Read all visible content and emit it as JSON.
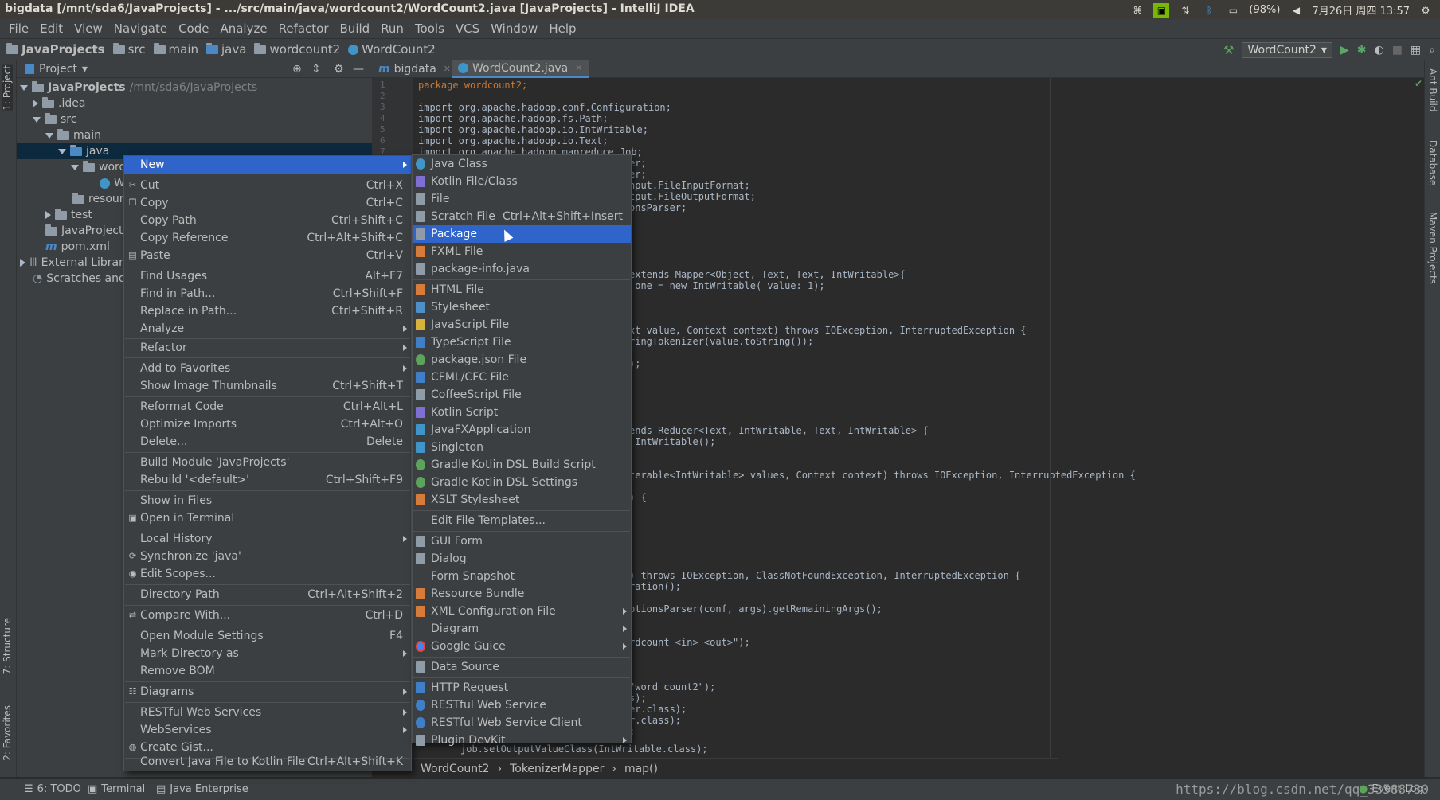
{
  "window": {
    "title": "bigdata [/mnt/sda6/JavaProjects] - .../src/main/java/wordcount2/WordCount2.java [JavaProjects] - IntelliJ IDEA",
    "tray": {
      "battery": "(98%)",
      "datetime": "7月26日 周四 13:57"
    }
  },
  "menubar": [
    "File",
    "Edit",
    "View",
    "Navigate",
    "Code",
    "Analyze",
    "Refactor",
    "Build",
    "Run",
    "Tools",
    "VCS",
    "Window",
    "Help"
  ],
  "navbar": {
    "crumbs": [
      "JavaProjects",
      "src",
      "main",
      "java",
      "wordcount2",
      "WordCount2"
    ],
    "run_config": "WordCount2"
  },
  "sidebar": {
    "left": [
      "1: Project",
      "7: Structure",
      "2: Favorites"
    ],
    "right": [
      "Ant Build",
      "Database",
      "Maven Projects"
    ]
  },
  "project": {
    "header": "Project",
    "tree": [
      {
        "label": "JavaProjects",
        "extra": "/mnt/sda6/JavaProjects"
      },
      {
        "label": ".idea"
      },
      {
        "label": "src"
      },
      {
        "label": "main"
      },
      {
        "label": "java"
      },
      {
        "label": "word"
      },
      {
        "label": "W"
      },
      {
        "label": "resourc"
      },
      {
        "label": "test"
      },
      {
        "label": "JavaProjects"
      },
      {
        "label": "pom.xml"
      },
      {
        "label": "External Librar"
      },
      {
        "label": "Scratches and C"
      }
    ]
  },
  "editor": {
    "tabs": [
      "bigdata",
      "WordCount2.java"
    ],
    "line_numbers": [
      "1",
      "2",
      "3",
      "4",
      "5",
      "6",
      "7"
    ],
    "code": [
      "package wordcount2;",
      "import org.apache.hadoop.conf.Configuration;",
      "import org.apache.hadoop.fs.Path;",
      "import org.apache.hadoop.io.IntWritable;",
      "import org.apache.hadoop.io.Text;",
      "import org.apache.hadoop.mapreduce.Job;",
      "er;",
      "er;",
      "nput.FileInputFormat;",
      "tput.FileOutputFormat;",
      "onsParser;",
      "extends Mapper<Object, Text, Text, IntWritable>{",
      " one = new IntWritable( value: 1);",
      "xt value, Context context) throws IOException, InterruptedException {",
      "ringTokenizer(value.toString());",
      ");",
      "ends Reducer<Text, IntWritable, Text, IntWritable> {",
      " IntWritable();",
      "terable<IntWritable> values, Context context) throws IOException, InterruptedException {",
      ") {",
      ") throws IOException, ClassNotFoundException, InterruptedException {",
      "ration();",
      "ptionsParser(conf, args).getRemainingArgs();",
      "rdcount <in> <out>\");",
      "\"word count2\");",
      "s);",
      "er.class);",
      "r.class);",
      ";",
      "job.setOutputValueClass(IntWritable.class);"
    ],
    "breadcrumb": [
      "WordCount2",
      "TokenizerMapper",
      "map()"
    ]
  },
  "context_menu": [
    {
      "label": "New",
      "shortcut": "",
      "icon": "",
      "submenu": true,
      "selected": true
    },
    {
      "label": "Cut",
      "shortcut": "Ctrl+X",
      "icon": "✂"
    },
    {
      "label": "Copy",
      "shortcut": "Ctrl+C",
      "icon": "❐"
    },
    {
      "label": "Copy Path",
      "shortcut": "Ctrl+Shift+C",
      "icon": ""
    },
    {
      "label": "Copy Reference",
      "shortcut": "Ctrl+Alt+Shift+C",
      "icon": ""
    },
    {
      "label": "Paste",
      "shortcut": "Ctrl+V",
      "icon": "▤"
    },
    {
      "label": "Find Usages",
      "shortcut": "Alt+F7",
      "icon": ""
    },
    {
      "label": "Find in Path...",
      "shortcut": "Ctrl+Shift+F",
      "icon": ""
    },
    {
      "label": "Replace in Path...",
      "shortcut": "Ctrl+Shift+R",
      "icon": ""
    },
    {
      "label": "Analyze",
      "shortcut": "",
      "icon": "",
      "submenu": true
    },
    {
      "label": "Refactor",
      "shortcut": "",
      "icon": "",
      "submenu": true
    },
    {
      "label": "Add to Favorites",
      "shortcut": "",
      "icon": "",
      "submenu": true
    },
    {
      "label": "Show Image Thumbnails",
      "shortcut": "Ctrl+Shift+T",
      "icon": ""
    },
    {
      "label": "Reformat Code",
      "shortcut": "Ctrl+Alt+L",
      "icon": ""
    },
    {
      "label": "Optimize Imports",
      "shortcut": "Ctrl+Alt+O",
      "icon": ""
    },
    {
      "label": "Delete...",
      "shortcut": "Delete",
      "icon": ""
    },
    {
      "label": "Build Module 'JavaProjects'",
      "shortcut": "",
      "icon": ""
    },
    {
      "label": "Rebuild '<default>'",
      "shortcut": "Ctrl+Shift+F9",
      "icon": ""
    },
    {
      "label": "Show in Files",
      "shortcut": "",
      "icon": ""
    },
    {
      "label": "Open in Terminal",
      "shortcut": "",
      "icon": "▣"
    },
    {
      "label": "Local History",
      "shortcut": "",
      "icon": "",
      "submenu": true
    },
    {
      "label": "Synchronize 'java'",
      "shortcut": "",
      "icon": "⟳"
    },
    {
      "label": "Edit Scopes...",
      "shortcut": "",
      "icon": "◉"
    },
    {
      "label": "Directory Path",
      "shortcut": "Ctrl+Alt+Shift+2",
      "icon": ""
    },
    {
      "label": "Compare With...",
      "shortcut": "Ctrl+D",
      "icon": "⇄"
    },
    {
      "label": "Open Module Settings",
      "shortcut": "F4",
      "icon": ""
    },
    {
      "label": "Mark Directory as",
      "shortcut": "",
      "icon": "",
      "submenu": true
    },
    {
      "label": "Remove BOM",
      "shortcut": "",
      "icon": ""
    },
    {
      "label": "Diagrams",
      "shortcut": "",
      "icon": "☷",
      "submenu": true
    },
    {
      "label": "RESTful Web Services",
      "shortcut": "",
      "icon": "",
      "submenu": true
    },
    {
      "label": "WebServices",
      "shortcut": "",
      "icon": "",
      "submenu": true
    },
    {
      "label": "Create Gist...",
      "shortcut": "",
      "icon": "◍"
    },
    {
      "label": "Convert Java File to Kotlin File",
      "shortcut": "Ctrl+Alt+Shift+K",
      "icon": ""
    }
  ],
  "new_submenu": [
    {
      "label": "Java Class",
      "color": "#3f95c8"
    },
    {
      "label": "Kotlin File/Class",
      "color": "#7f6fd3"
    },
    {
      "label": "File",
      "color": "#8f9ba7"
    },
    {
      "label": "Scratch File",
      "shortcut": "Ctrl+Alt+Shift+Insert",
      "color": "#8f9ba7"
    },
    {
      "label": "Package",
      "color": "#8f9ba7",
      "selected": true
    },
    {
      "label": "FXML File",
      "color": "#d67b3a"
    },
    {
      "label": "package-info.java",
      "color": "#8f9ba7"
    },
    {
      "label": "HTML File",
      "color": "#d67b3a"
    },
    {
      "label": "Stylesheet",
      "color": "#4f8fc8"
    },
    {
      "label": "JavaScript File",
      "color": "#d6b33a"
    },
    {
      "label": "TypeScript File",
      "color": "#3f7fc8"
    },
    {
      "label": "package.json File",
      "color": "#5ca35c"
    },
    {
      "label": "CFML/CFC File",
      "color": "#3f7fc8"
    },
    {
      "label": "CoffeeScript File",
      "color": "#8f9ba7"
    },
    {
      "label": "Kotlin Script",
      "color": "#7f6fd3"
    },
    {
      "label": "JavaFXApplication",
      "color": "#3f95c8"
    },
    {
      "label": "Singleton",
      "color": "#3f95c8"
    },
    {
      "label": "Gradle Kotlin DSL Build Script",
      "color": "#5ca35c"
    },
    {
      "label": "Gradle Kotlin DSL Settings",
      "color": "#5ca35c"
    },
    {
      "label": "XSLT Stylesheet",
      "color": "#d67b3a"
    },
    {
      "label": "Edit File Templates...",
      "color": ""
    },
    {
      "label": "GUI Form",
      "color": "#8f9ba7"
    },
    {
      "label": "Dialog",
      "color": "#8f9ba7"
    },
    {
      "label": "Form Snapshot",
      "color": ""
    },
    {
      "label": "Resource Bundle",
      "color": "#d67b3a"
    },
    {
      "label": "XML Configuration File",
      "color": "#d67b3a",
      "submenu": true
    },
    {
      "label": "Diagram",
      "color": "",
      "submenu": true
    },
    {
      "label": "Google Guice",
      "color": "#4285f4",
      "submenu": true
    },
    {
      "label": "Data Source",
      "color": "#8f9ba7"
    },
    {
      "label": "HTTP Request",
      "color": "#3f7fc8"
    },
    {
      "label": "RESTful Web Service",
      "color": "#3f7fc8"
    },
    {
      "label": "RESTful Web Service Client",
      "color": "#3f7fc8"
    },
    {
      "label": "Plugin DevKit",
      "color": "#8f9ba7",
      "submenu": true
    }
  ],
  "statusbar": {
    "items": [
      "6: TODO",
      "Terminal",
      "Java Enterprise"
    ],
    "event_log": "Event Log",
    "watermark": "https://blog.csdn.net/qq_33588730"
  }
}
